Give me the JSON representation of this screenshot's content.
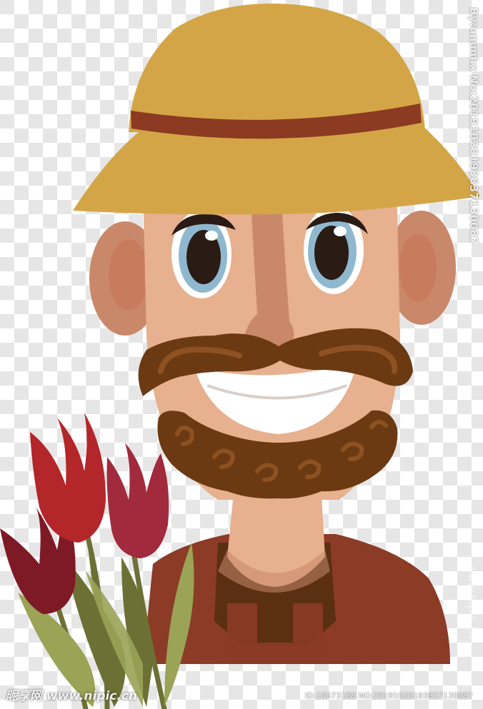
{
  "illustration": {
    "subject": "gardener-with-tulips",
    "colors": {
      "hat": "#D4A546",
      "hat_band": "#8C3A22",
      "skin": "#E7B08E",
      "skin_shadow": "#C9886A",
      "ear_inner": "#C97B5E",
      "hair": "#6B3A12",
      "hair_curl": "#8E5222",
      "eye_iris": "#8FB8CE",
      "eye_pupil": "#2A1B14",
      "shirt": "#5A2F12",
      "overalls": "#8B3B26",
      "tulip_red": "#B3262A",
      "tulip_crimson": "#A12A3C",
      "tulip_dark": "#7E1A26",
      "leaf_light": "#9AA356",
      "leaf_dark": "#6D7034"
    }
  },
  "watermarks": {
    "side_text": "By:ummhx No:20191020193837130087",
    "site_vertical": "www.nipic.cn",
    "logo": "昵享网 www.nipic.cn",
    "id_line": "ID:10673188 NO:20191020193837130087"
  }
}
